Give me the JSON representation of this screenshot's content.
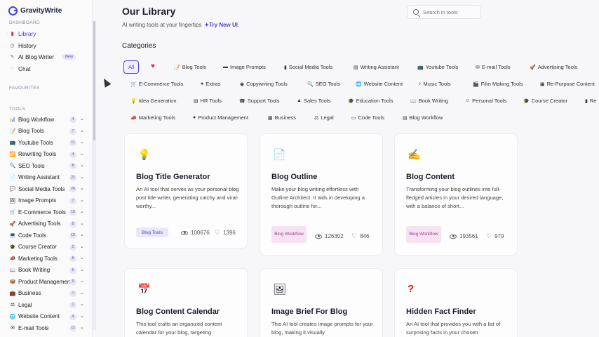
{
  "app": {
    "name": "GravityWrite"
  },
  "sidebar": {
    "section_dashboard": "DASHBOARD",
    "section_favourites": "FAVOURITES",
    "section_tools": "TOOLS",
    "nav": [
      {
        "label": "Library",
        "icon": "book-icon"
      },
      {
        "label": "History",
        "icon": "history-icon"
      },
      {
        "label": "AI Blog Writer",
        "icon": "blog-writer-icon",
        "badge": "New"
      },
      {
        "label": "Chat",
        "icon": "chat-icon"
      }
    ],
    "tools": [
      {
        "label": "Blog Workflow",
        "count": "4",
        "icon": "workflow-icon"
      },
      {
        "label": "Blog Tools",
        "count": "7",
        "icon": "blog-tools-icon"
      },
      {
        "label": "Youtube Tools",
        "count": "11",
        "icon": "youtube-icon"
      },
      {
        "label": "Rewriting Tools",
        "count": "4",
        "icon": "rewrite-icon"
      },
      {
        "label": "SEO Tools",
        "count": "8",
        "icon": "seo-icon"
      },
      {
        "label": "Writing Assistant",
        "count": "22",
        "icon": "writing-icon"
      },
      {
        "label": "Social Media Tools",
        "count": "24",
        "icon": "social-icon"
      },
      {
        "label": "Image Prompts",
        "count": "7",
        "icon": "image-icon"
      },
      {
        "label": "E-Commerce Tools",
        "count": "18",
        "icon": "ecommerce-icon"
      },
      {
        "label": "Advertising Tools",
        "count": "9",
        "icon": "ads-icon"
      },
      {
        "label": "Code Tools",
        "count": "10",
        "icon": "code-icon"
      },
      {
        "label": "Course Creator",
        "count": "2",
        "icon": "course-icon"
      },
      {
        "label": "Marketing Tools",
        "count": "8",
        "icon": "marketing-icon"
      },
      {
        "label": "Book Writing",
        "count": "5",
        "icon": "book-writing-icon"
      },
      {
        "label": "Product Management",
        "count": "9",
        "icon": "product-icon"
      },
      {
        "label": "Business",
        "count": "7",
        "icon": "business-icon"
      },
      {
        "label": "Legal",
        "count": "1",
        "icon": "legal-icon"
      },
      {
        "label": "Website Content",
        "count": "4",
        "icon": "website-icon"
      },
      {
        "label": "E-mail Tools",
        "count": "11",
        "icon": "email-icon"
      }
    ]
  },
  "header": {
    "title": "Our Library",
    "subtitle": "AI writing tools at your fingertips",
    "try_link": "Try New UI",
    "search_placeholder": "Search in tools"
  },
  "categories": {
    "title": "Categories",
    "row1": [
      "All",
      "♥",
      "Blog Tools",
      "Image Prompts",
      "Social Media Tools",
      "Writing Assistant",
      "Youtube Tools",
      "E-mail Tools",
      "Advertising Tools"
    ],
    "row2": [
      "E-Commerce Tools",
      "Extras",
      "Copywriting Tools",
      "SEO Tools",
      "Website Content",
      "Music Tools",
      "Film Making Tools",
      "Re-Purpose Content"
    ],
    "row3": [
      "Idea Generation",
      "HR Tools",
      "Support Tools",
      "Sales Tools",
      "Education Tools",
      "Book Writing",
      "Personal Tools",
      "Course Creator",
      "Re"
    ],
    "row4": [
      "Marketing Tools",
      "Product Management",
      "Business",
      "Legal",
      "Code Tools",
      "Blog Workflow"
    ]
  },
  "cards": [
    {
      "title": "Blog Title Generator",
      "desc": "An AI tool that serves as your personal blog post title writer, generating catchy and viral-worthy...",
      "tag": "Blog Tools",
      "views": "100676",
      "likes": "1396",
      "icon": "lightbulb-icon"
    },
    {
      "title": "Blog Outline",
      "desc": "Make your blog writing effortless with Outline Architect. It aids in developing a thorough outline for...",
      "tag": "Blog Workflow",
      "views": "126302",
      "likes": "846",
      "icon": "document-icon"
    },
    {
      "title": "Blog Content",
      "desc": "Transforming your blog outlines into full-fledged articles in your desired language, with a balance of short...",
      "tag": "Blog Workflow",
      "views": "193561",
      "likes": "979",
      "icon": "writing-hand-icon"
    },
    {
      "title": "Blog Content Calendar",
      "desc": "This tool crafts an organized content calendar for your blog, targeting",
      "icon": "calendar-icon"
    },
    {
      "title": "Image Brief For Blog",
      "desc": "This AI tool creates image prompts for your blog, making it visually",
      "icon": "picture-icon"
    },
    {
      "title": "Hidden Fact Finder",
      "desc": "An AI tool that provides you with a list of surprising facts in your chosen",
      "icon": "question-icon"
    }
  ]
}
